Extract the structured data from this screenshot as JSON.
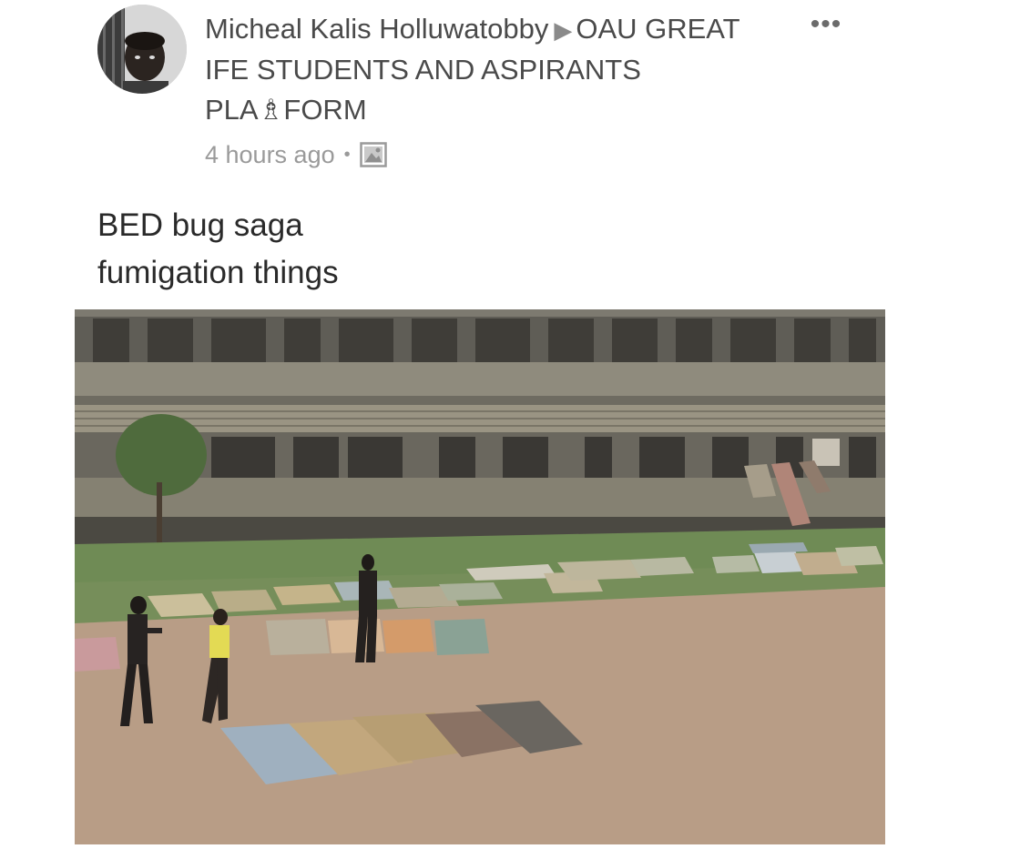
{
  "post": {
    "author": "Micheal Kalis Holluwatobby",
    "group": "OAU GREAT IFE STUDENTS AND ASPIRANTS PLA♗FORM",
    "arrow_icon": "triangle-right-icon",
    "timestamp": "4 hours ago",
    "separator": "•",
    "privacy_icon": "photo-album-icon",
    "more_icon": "more-horizontal-icon",
    "more_label": "•••",
    "caption_lines": [
      "BED bug saga",
      "fumigation things"
    ]
  },
  "colors": {
    "author_text": "#4a4a4a",
    "meta_text": "#9a9a9a",
    "caption_text": "#2a2a2a",
    "ground": "#b9a08a",
    "grass": "#6f8b55",
    "building": "#8c8778"
  }
}
